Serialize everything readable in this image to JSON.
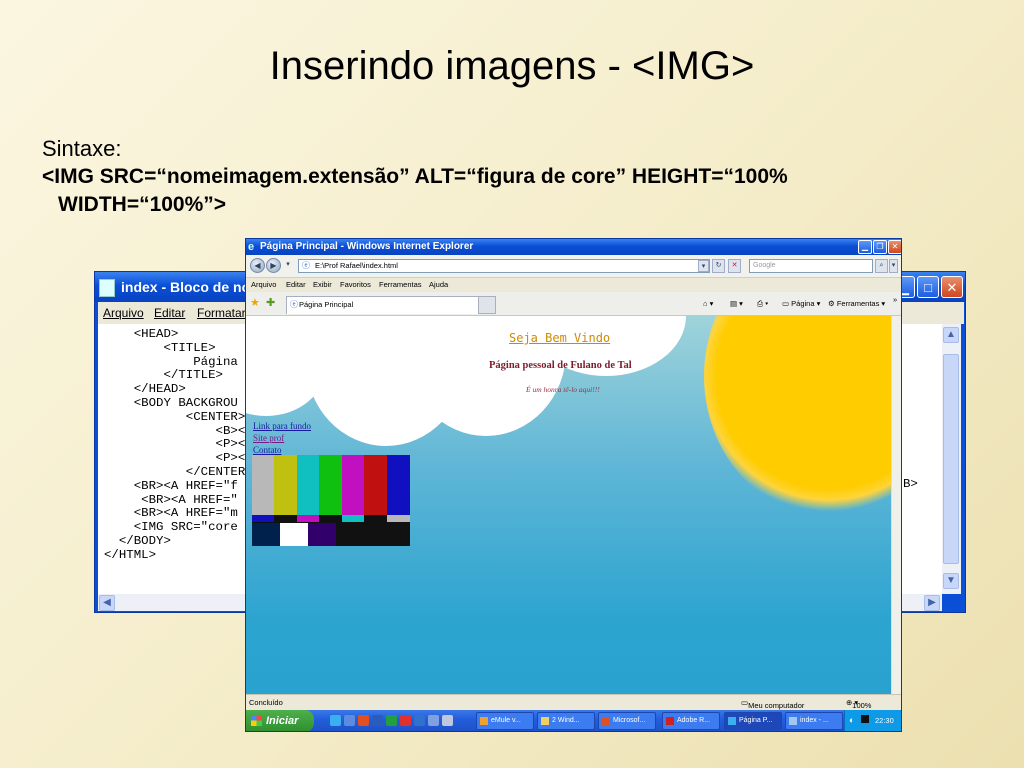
{
  "slide": {
    "title": "Inserindo imagens - <IMG>",
    "syntax_label": "Sintaxe:",
    "syntax_line1": "<IMG SRC=“nomeimagem.extensão” ALT=“figura de core” HEIGHT=“100%",
    "syntax_line2": "WIDTH=“100%”>"
  },
  "notepad": {
    "title": "index - Bloco de notas",
    "menu": [
      "Arquivo",
      "Editar",
      "Formatar"
    ],
    "code_lines": [
      "    <HEAD>",
      "        <TITLE>",
      "            Página P",
      "        </TITLE>",
      "    </HEAD>",
      "    <BODY BACKGROU",
      "           <CENTER>",
      "               <B><U><",
      "               <P><B><",
      "               <P><I><",
      "           </CENTER>",
      "    <BR><A HREF=\"f",
      "     <BR><A HREF=\"",
      "    <BR><A HREF=\"m",
      "    <IMG SRC=\"core",
      "  </BODY>",
      "</HTML>"
    ],
    "right_fragment": "B>"
  },
  "ie": {
    "title": "Página Principal - Windows Internet Explorer",
    "address": "E:\\Prof Rafael\\index.html",
    "search_placeholder": "Google",
    "menu": [
      "Arquivo",
      "Editar",
      "Exibir",
      "Favoritos",
      "Ferramentas",
      "Ajuda"
    ],
    "tab_label": "Página Principal",
    "toolbar_page": "Página",
    "toolbar_tools": "Ferramentas",
    "content": {
      "heading": "Seja Bem Vindo",
      "subheading": "Página pessoal de Fulano de Tal",
      "italic": "É um honra tê-lo aqui!!!",
      "links": [
        "Link para fundo",
        "Site prof",
        "Contato"
      ]
    },
    "status": {
      "left": "Concluído",
      "zone": "Meu computador",
      "zoom": "100%"
    },
    "taskbar": {
      "start": "Iniciar",
      "tasks": [
        "eMule v...",
        "2 Wind...",
        "Microsof...",
        "Adobe R...",
        "Página P...",
        "index - ..."
      ],
      "clock": "22:30"
    }
  },
  "colors": {
    "title_bar_blue": "#0a4fd6",
    "heading_orange": "#d08a00",
    "subheading_maroon": "#7a1c2a",
    "sun_yellow": "#ffcc00",
    "sky_blue": "#2da4d0"
  }
}
